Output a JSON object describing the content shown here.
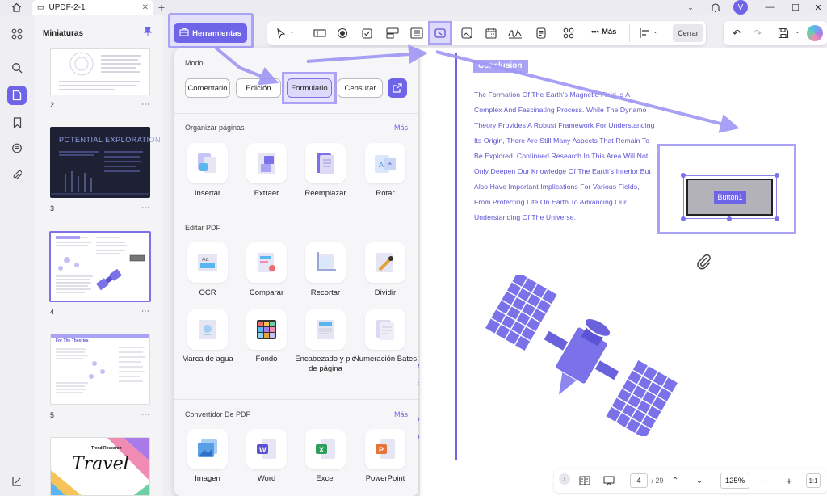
{
  "app": {
    "tab_title": "UPDF-2-1",
    "avatar_letter": "V"
  },
  "thumbnails": {
    "title": "Miniaturas",
    "pages": [
      {
        "num": "2"
      },
      {
        "num": "3",
        "caption": "POTENTIAL EXPLORATION"
      },
      {
        "num": "4"
      },
      {
        "num": "5",
        "caption": "For The Theories"
      },
      {
        "num": "",
        "caption": "Travel",
        "sub": "Trend Research"
      }
    ]
  },
  "tools_button": {
    "label": "Herramientas"
  },
  "toolbar": {
    "more_label": "Más",
    "close_label": "Cerrar"
  },
  "panel": {
    "mode_title": "Modo",
    "modes": [
      "Comentario",
      "Edición",
      "Formulario",
      "Censurar"
    ],
    "organize": {
      "title": "Organizar páginas",
      "more": "Más",
      "items": [
        "Insertar",
        "Extraer",
        "Reemplazar",
        "Rotar"
      ]
    },
    "edit": {
      "title": "Editar PDF",
      "items": [
        "OCR",
        "Comparar",
        "Recortar",
        "Dividir",
        "Marca de agua",
        "Fondo",
        "Encabezado y pie de página",
        "Numeración Bates"
      ]
    },
    "convert": {
      "title": "Convertidor De PDF",
      "more": "Más",
      "items": [
        "Imagen",
        "Word",
        "Excel",
        "PowerPoint"
      ]
    }
  },
  "document": {
    "heading": "Conclusion",
    "lines": [
      "The Formation Of The Earth's Magnetic Field Is A",
      "Complex And Fascinating Process. While The Dynamo",
      "Theory Provides A Robust Framework For Understanding",
      "Its Origin, There Are Still Many Aspects That Remain To",
      "Be Explored. Continued Research In This Area Will Not",
      "Only Deepen Our Knowledge Of The Earth's Interior But",
      "Also Have Important Implications For Various Fields,",
      "From Protecting Life On Earth To Advancing Our",
      "Understanding Of The Universe."
    ],
    "form_button": "Button1"
  },
  "bottom": {
    "page_current": "4",
    "page_total": "/ 29",
    "zoom": "125%"
  },
  "colors": {
    "accent": "#6e64e8",
    "highlight": "#aaa2f5",
    "doc_text": "#5b53d4"
  }
}
